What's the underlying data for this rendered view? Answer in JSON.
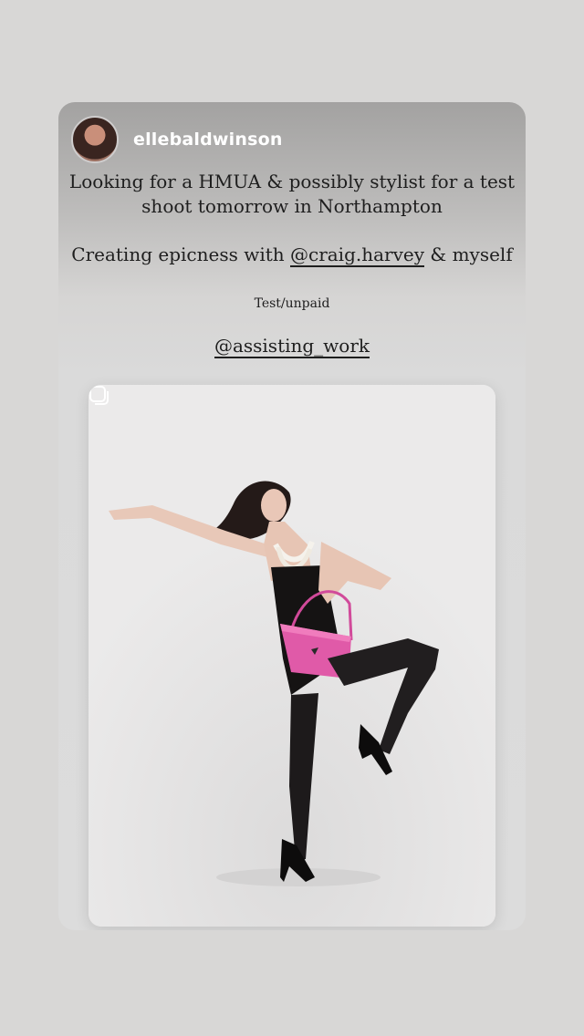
{
  "post": {
    "username": "ellebaldwinson",
    "caption_line1": "Looking for a HMUA & possibly stylist for a test shoot tomorrow in Northampton",
    "caption_line2_prefix": "Creating epicness with ",
    "caption_mention1": "@craig.harvey",
    "caption_line2_suffix": " & myself",
    "caption_small": "Test/unpaid",
    "caption_mention2": "@assisting_work"
  },
  "icons": {
    "avatar": "avatar-photo",
    "multi": "multiple-photos-icon"
  }
}
